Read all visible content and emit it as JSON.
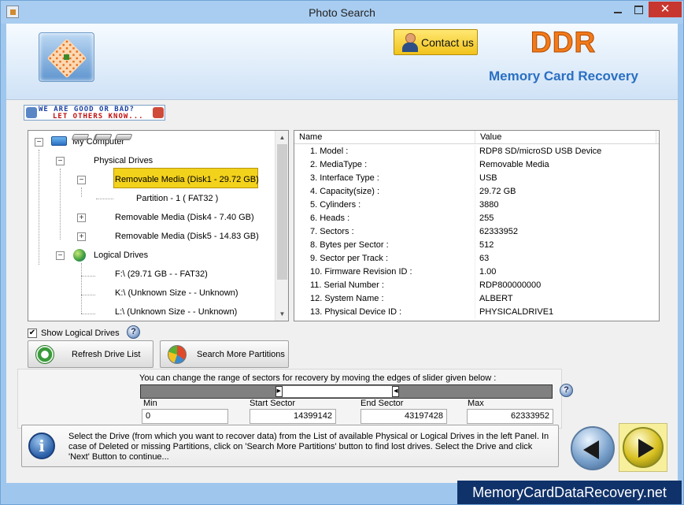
{
  "window": {
    "title": "Photo Search",
    "close_glyph": "✕"
  },
  "header": {
    "contact_label": "Contact us",
    "brand": "DDR",
    "product": "Memory Card Recovery",
    "feedback_line1": "WE ARE GOOD OR BAD?",
    "feedback_line2": "LET OTHERS KNOW..."
  },
  "tree": {
    "root": "My Computer",
    "physical_group": "Physical Drives",
    "physical": [
      {
        "label": "Removable Media (Disk1 - 29.72 GB)",
        "selected": true,
        "expanded": true
      },
      {
        "label": "Removable Media (Disk4 - 7.40 GB)",
        "selected": false,
        "expanded": false
      },
      {
        "label": "Removable Media (Disk5 - 14.83 GB)",
        "selected": false,
        "expanded": false
      }
    ],
    "partition": "Partition - 1 ( FAT32 )",
    "logical_group": "Logical Drives",
    "logical": [
      {
        "label": "F:\\ (29.71 GB -  - FAT32)"
      },
      {
        "label": "K:\\ (Unknown Size  -  - Unknown)"
      },
      {
        "label": "L:\\ (Unknown Size  -  - Unknown)"
      }
    ]
  },
  "table": {
    "headers": [
      "Name",
      "Value"
    ],
    "rows": [
      {
        "name": "1. Model :",
        "value": "RDP8 SD/microSD USB Device"
      },
      {
        "name": "2. MediaType :",
        "value": "Removable Media"
      },
      {
        "name": "3. Interface Type :",
        "value": "USB"
      },
      {
        "name": "4. Capacity(size) :",
        "value": "29.72 GB"
      },
      {
        "name": "5. Cylinders :",
        "value": "3880"
      },
      {
        "name": "6. Heads :",
        "value": "255"
      },
      {
        "name": "7. Sectors :",
        "value": "62333952"
      },
      {
        "name": "8. Bytes per Sector :",
        "value": "512"
      },
      {
        "name": "9. Sector per Track :",
        "value": "63"
      },
      {
        "name": "10. Firmware Revision ID :",
        "value": "1.00"
      },
      {
        "name": "11. Serial Number :",
        "value": "RDP800000000"
      },
      {
        "name": "12. System Name :",
        "value": "ALBERT"
      },
      {
        "name": "13. Physical Device ID :",
        "value": "PHYSICALDRIVE1"
      }
    ]
  },
  "controls": {
    "show_logical_label": "Show Logical Drives",
    "show_logical_checked": true,
    "check_glyph": "✔",
    "help_glyph": "?",
    "refresh_label": "Refresh Drive List",
    "search_label": "Search More Partitions"
  },
  "slider": {
    "instruction": "You can change the range of sectors for recovery by moving the edges of slider given below :",
    "min": 0,
    "max": 62333952,
    "start": 14399142,
    "end": 43197428,
    "min_label": "Min",
    "start_label": "Start Sector",
    "end_label": "End Sector",
    "max_label": "Max",
    "min_value": "0",
    "start_value": "14399142",
    "end_value": "43197428",
    "max_value": "62333952"
  },
  "info": {
    "glyph": "i",
    "text": "Select the Drive (from which you want to recover data) from the List of available Physical or Logical Drives in the left Panel. In case of Deleted or missing Partitions, click on 'Search More Partitions' button to find lost drives. Select the Drive and click 'Next' Button to continue..."
  },
  "footer": {
    "website": "MemoryCardDataRecovery.net"
  },
  "colors": {
    "selection": "#f3d21c",
    "brand_orange": "#f27a1a",
    "product_blue": "#2a6fc2",
    "website_bg": "#10326a"
  }
}
